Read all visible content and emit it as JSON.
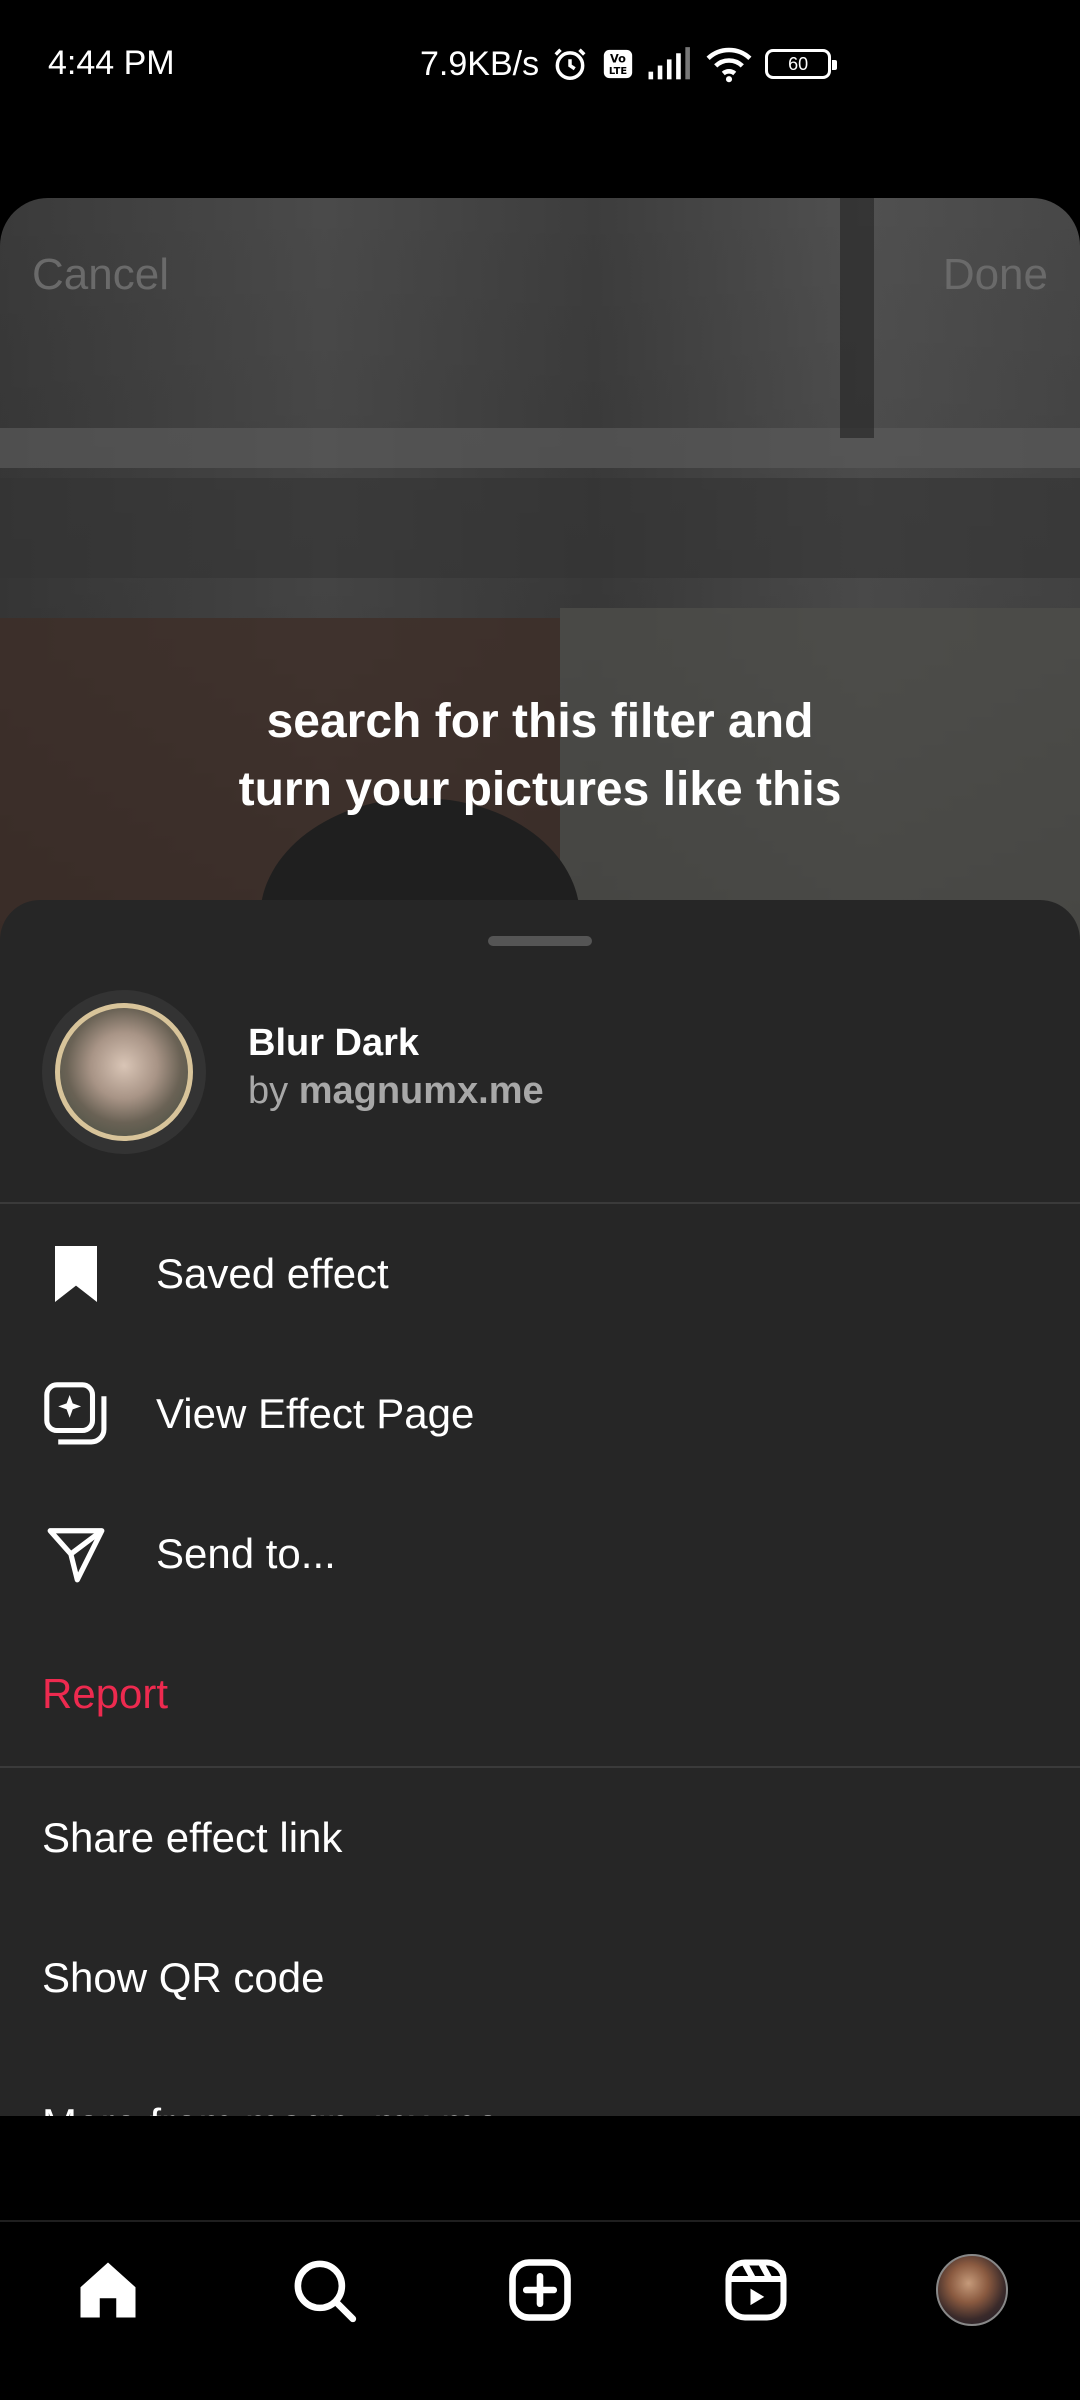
{
  "status_bar": {
    "time": "4:44 PM",
    "network_speed": "7.9KB/s",
    "battery_level": "60",
    "icons": [
      "alarm-icon",
      "volte-icon",
      "signal-icon",
      "wifi-icon",
      "battery-icon"
    ]
  },
  "preview": {
    "cancel_label": "Cancel",
    "done_label": "Done",
    "caption_line1": "search for this filter and",
    "caption_line2": "turn your pictures like this"
  },
  "effect": {
    "name": "Blur Dark",
    "by_prefix": "by",
    "creator": "magnumx.me"
  },
  "menu": {
    "saved_effect": "Saved effect",
    "view_effect_page": "View Effect Page",
    "send_to": "Send to...",
    "report": "Report",
    "share_effect_link": "Share effect link",
    "show_qr_code": "Show QR code",
    "more_from": "More from magnumx.me"
  },
  "nav": {
    "items": [
      "home-icon",
      "search-icon",
      "create-icon",
      "reels-icon",
      "profile-avatar"
    ]
  },
  "colors": {
    "sheet_bg": "#262626",
    "report_red": "#ed2a4f",
    "secondary_text": "#a8a8a8"
  }
}
